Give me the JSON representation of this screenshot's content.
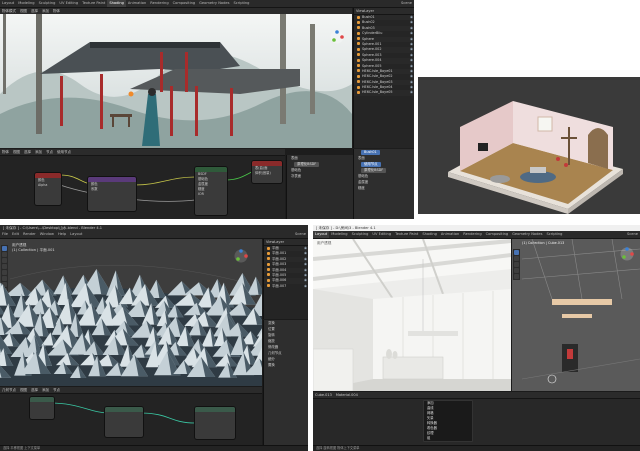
{
  "colors": {
    "blender_blue": "#4772b3",
    "panel_bg": "#1d1d1d",
    "header_bg": "#2b2b2b",
    "object_orange": "#e89c3a",
    "node_red_header": "#8a2a2a",
    "node_purple_header": "#5a3a7a",
    "node_green_header": "#2f5a3a"
  },
  "panel_a": {
    "workspace_tabs": [
      "Layout",
      "Modeling",
      "Sculpting",
      "UV Editing",
      "Texture Paint",
      "Shading",
      "Animation",
      "Rendering",
      "Compositing",
      "Geometry Nodes",
      "Scripting"
    ],
    "active_tab": "Shading",
    "scene_label": "Scene",
    "view_layer_label": "ViewLayer",
    "header_items": [
      "物体模式",
      "视图",
      "选择",
      "添加",
      "物体"
    ],
    "outliner_items": [
      "Bush01",
      "Bush02",
      "Bush03",
      "CylinderBiiu",
      "Sphere",
      "Sphere.001",
      "Sphere.002",
      "Sphere.003",
      "Sphere.004",
      "Sphere.005",
      "HE6C.Isle_Boye01",
      "HE6C.Isle_Boye02",
      "HE6C.Isle_Boye03",
      "HE6C.Isle_Boye04",
      "HE6C.Isle_Boye05"
    ],
    "node_header_items": [
      "物体",
      "视图",
      "选择",
      "添加",
      "节点",
      "使用节点"
    ],
    "material_name": "Bush01",
    "nodes": [
      {
        "title": "",
        "rows": [
          "颜色",
          "Alpha"
        ]
      },
      {
        "title": "",
        "rows": [
          "颜色",
          "系数",
          "",
          ""
        ]
      },
      {
        "title": "",
        "rows": [
          "BSDF",
          "基础色",
          "金属度",
          "糙度",
          "IOR",
          "Alpha"
        ]
      },
      {
        "title": "",
        "rows": [
          "表(曲)面",
          "体积(音量)",
          "置换"
        ]
      }
    ],
    "props_items": [
      "Bush01",
      "表面",
      "使用节点",
      "表面",
      "原理化BSDF",
      "基础色",
      "次表面",
      "金属度",
      "糙度"
    ]
  },
  "panel_b": {
    "description": ""
  },
  "panel_c": {
    "title_bar": "[ 未保存 ] - C:\\Users\\...\\Desktop\\山水.blend - Blender 4.1",
    "workspace_tabs": [
      "File",
      "Edit",
      "Render",
      "Window",
      "Help",
      "Layout"
    ],
    "scene_label": "Scene",
    "view_layer_label": "ViewLayer",
    "viewport_info": [
      "用户透视",
      "(1) Collection | 平面.001"
    ],
    "outliner_items": [
      "平面",
      "平面.001",
      "平面.002",
      "平面.003",
      "平面.004",
      "平面.005",
      "平面.006",
      "平面.007"
    ],
    "props_items": [
      "变换",
      "位置",
      "旋转",
      "缩放",
      "修改器",
      "几何节点",
      "细分",
      "置换"
    ],
    "node_header_items": [
      "几何节点",
      "视图",
      "选择",
      "添加",
      "节点"
    ],
    "node_group_name": "几何节点",
    "status": "选择   平移视图   上下文菜单"
  },
  "panel_d": {
    "title_bar": "[ 未保存 ] - D:\\房间\\3 - Blender 4.1",
    "workspace_tabs": [
      "Layout",
      "Modeling",
      "Sculpting",
      "UV Editing",
      "Texture Paint",
      "Shading",
      "Animation",
      "Rendering",
      "Compositing",
      "Geometry Nodes",
      "Scripting"
    ],
    "active_tab": "Layout",
    "scene_label": "Scene",
    "viewport_info": [
      "用户透视",
      "(1) Collection | Cube.013"
    ],
    "node_header_items": [
      "Cube.013",
      "Material.004"
    ],
    "dropdown_items": [
      "添加",
      "曲线",
      "网格",
      "矢量",
      "转换器",
      "着色器",
      "纹理",
      "组"
    ],
    "status": "选择   旋转视图   物体上下文菜单"
  }
}
